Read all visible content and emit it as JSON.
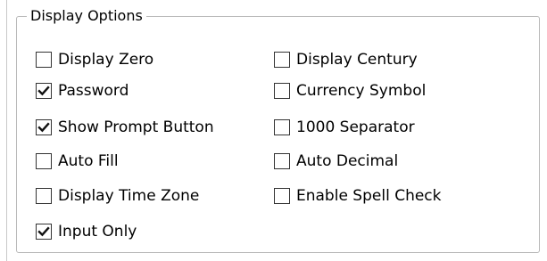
{
  "group": {
    "title": "Display Options"
  },
  "options": [
    {
      "label": "Display Zero",
      "checked": false
    },
    {
      "label": "Password",
      "checked": true
    },
    {
      "label": "Show Prompt Button",
      "checked": true
    },
    {
      "label": "Auto Fill",
      "checked": false
    },
    {
      "label": "Display Time Zone",
      "checked": false
    },
    {
      "label": "Input Only",
      "checked": true
    },
    {
      "label": "Display Century",
      "checked": false
    },
    {
      "label": "Currency Symbol",
      "checked": false
    },
    {
      "label": "1000 Separator",
      "checked": false
    },
    {
      "label": "Auto Decimal",
      "checked": false
    },
    {
      "label": "Enable Spell Check",
      "checked": false
    }
  ]
}
